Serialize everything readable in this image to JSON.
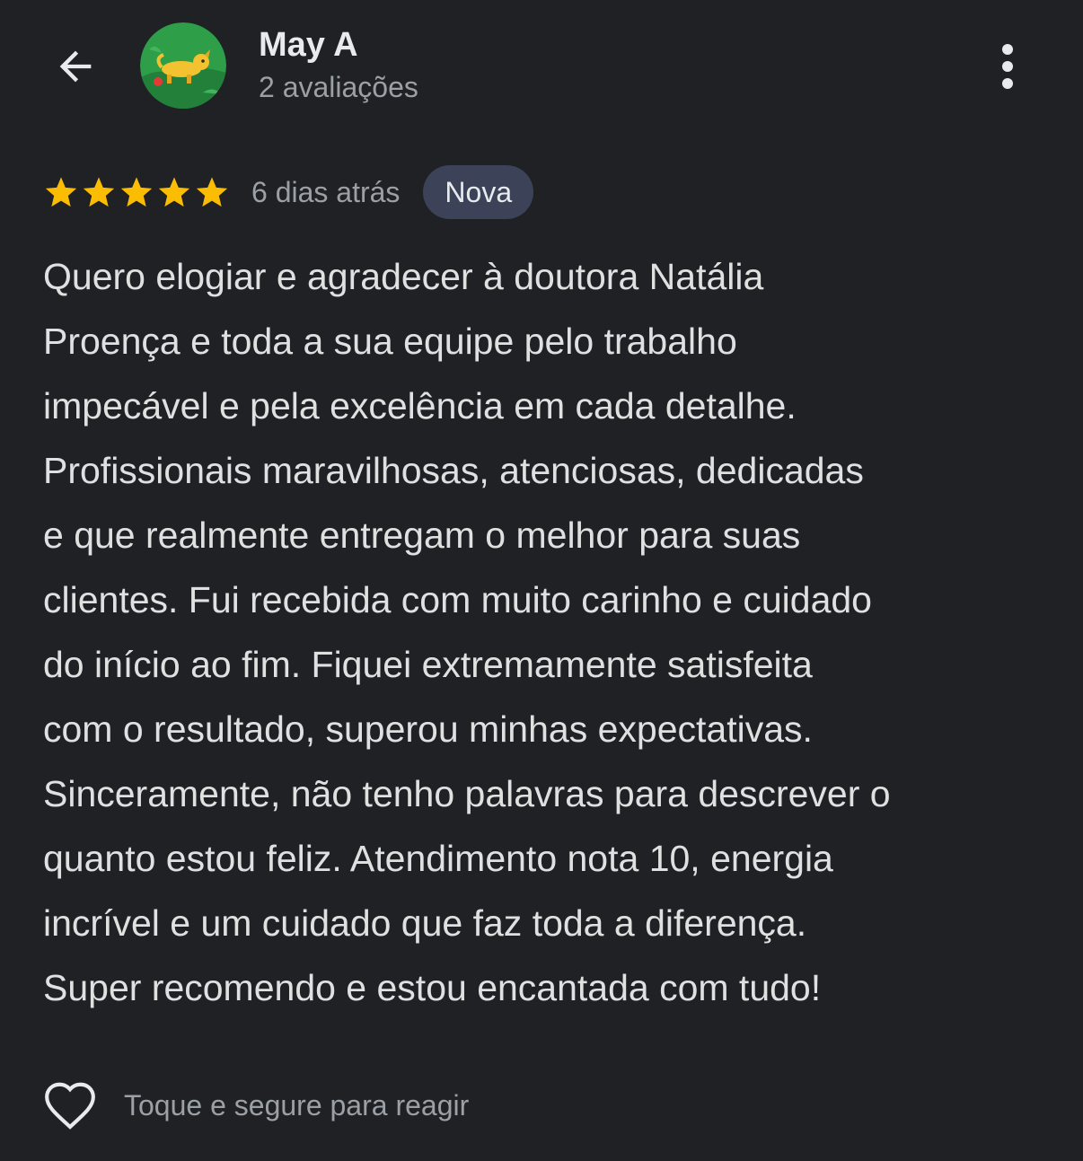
{
  "header": {
    "back_icon": "arrow-left-icon",
    "user_name": "May A",
    "user_reviews": "2 avaliações",
    "more_icon": "more-vert-icon"
  },
  "review": {
    "rating": 5,
    "max_rating": 5,
    "time_ago": "6 dias atrás",
    "badge": "Nova",
    "lines": [
      "Quero elogiar e agradecer à doutora Natália",
      "Proença e toda a sua equipe pelo trabalho",
      "impecável e pela excelência em cada detalhe.",
      "Profissionais maravilhosas, atenciosas, dedicadas",
      "e que realmente entregam o melhor para suas",
      "clientes. Fui recebida com muito carinho e cuidado",
      "do início ao fim. Fiquei extremamente satisfeita",
      "com o resultado, superou minhas expectativas.",
      "Sinceramente, não tenho palavras para descrever o",
      "quanto estou feliz. Atendimento nota 10, energia",
      "incrível e um cuidado que faz toda a diferença.",
      "Super recomendo e estou encantada com tudo!"
    ]
  },
  "reaction": {
    "icon": "heart-outline-icon",
    "hint": "Toque e segure para reagir"
  },
  "colors": {
    "background": "#202124",
    "star": "#fbbc04",
    "badge_bg": "#3c4258",
    "secondary_text": "#9aa0a6"
  }
}
